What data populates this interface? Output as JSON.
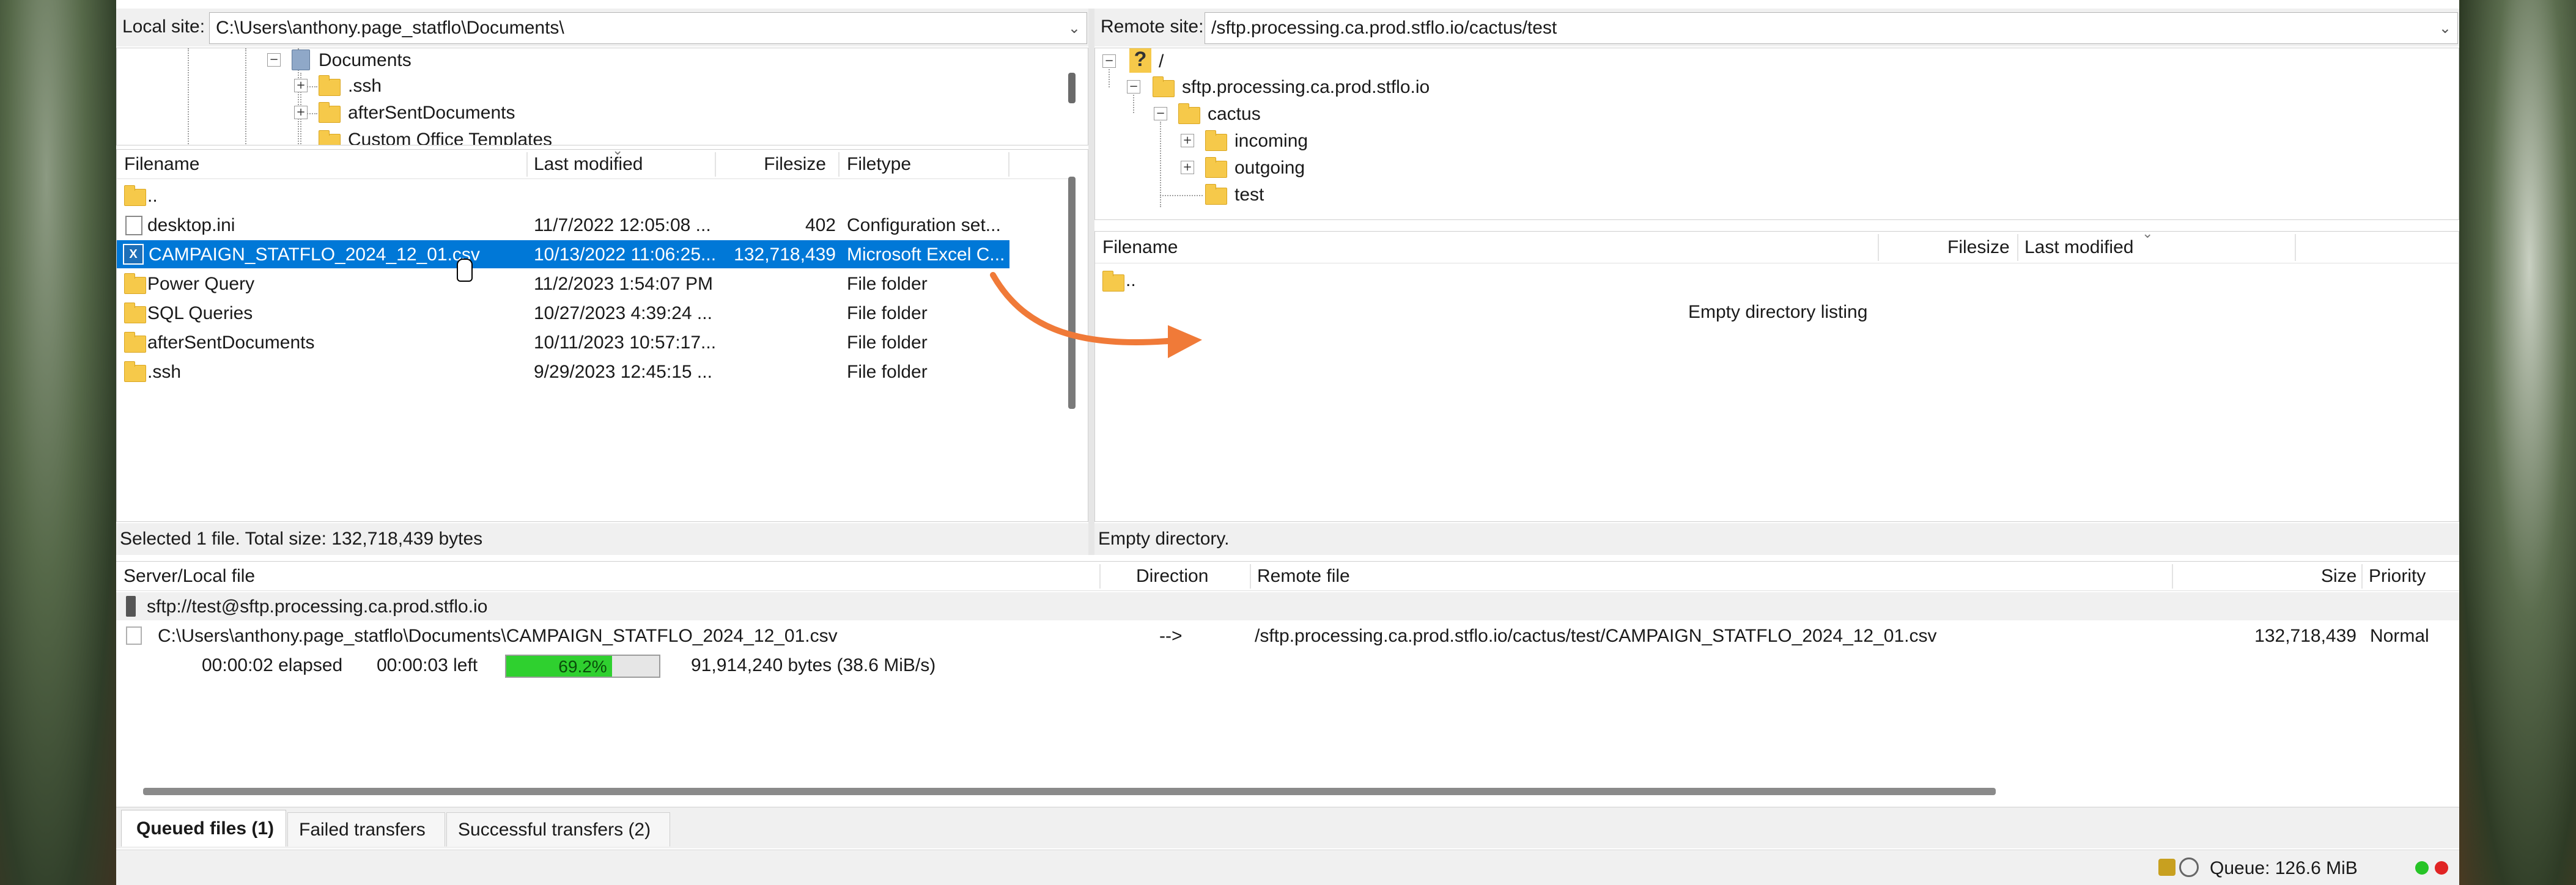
{
  "local": {
    "label": "Local site:",
    "path": "C:\\Users\\anthony.page_statflo\\Documents\\",
    "tree": {
      "documents": "Documents",
      "ssh": ".ssh",
      "after": "afterSentDocuments",
      "custom": "Custom Office Templates"
    },
    "columns": {
      "filename": "Filename",
      "modified": "Last modified",
      "size": "Filesize",
      "type": "Filetype"
    },
    "rows": [
      {
        "name": "..",
        "modified": "",
        "size": "",
        "type": ""
      },
      {
        "name": "desktop.ini",
        "modified": "11/7/2022 12:05:08 ...",
        "size": "402",
        "type": "Configuration set..."
      },
      {
        "name": "CAMPAIGN_STATFLO_2024_12_01.csv",
        "modified": "10/13/2022 11:06:25...",
        "size": "132,718,439",
        "type": "Microsoft Excel C..."
      },
      {
        "name": "Power Query",
        "modified": "11/2/2023 1:54:07 PM",
        "size": "",
        "type": "File folder"
      },
      {
        "name": "SQL Queries",
        "modified": "10/27/2023 4:39:24 ...",
        "size": "",
        "type": "File folder"
      },
      {
        "name": "afterSentDocuments",
        "modified": "10/11/2023 10:57:17...",
        "size": "",
        "type": "File folder"
      },
      {
        "name": ".ssh",
        "modified": "9/29/2023 12:45:15 ...",
        "size": "",
        "type": "File folder"
      }
    ],
    "status": "Selected 1 file. Total size: 132,718,439 bytes"
  },
  "remote": {
    "label": "Remote site:",
    "path": "/sftp.processing.ca.prod.stflo.io/cactus/test",
    "tree": {
      "root": "/",
      "host": "sftp.processing.ca.prod.stflo.io",
      "cactus": "cactus",
      "incoming": "incoming",
      "outgoing": "outgoing",
      "test": "test"
    },
    "columns": {
      "filename": "Filename",
      "size": "Filesize",
      "modified": "Last modified"
    },
    "rows": [
      {
        "name": ".."
      }
    ],
    "empty": "Empty directory listing",
    "status": "Empty directory."
  },
  "queue": {
    "columns": {
      "server": "Server/Local file",
      "direction": "Direction",
      "remote": "Remote file",
      "size": "Size",
      "priority": "Priority"
    },
    "server": "sftp://test@sftp.processing.ca.prod.stflo.io",
    "local_file": "C:\\Users\\anthony.page_statflo\\Documents\\CAMPAIGN_STATFLO_2024_12_01.csv",
    "direction": "-->",
    "remote_file": "/sftp.processing.ca.prod.stflo.io/cactus/test/CAMPAIGN_STATFLO_2024_12_01.csv",
    "size": "132,718,439",
    "priority": "Normal",
    "elapsed": "00:00:02 elapsed",
    "left": "00:00:03 left",
    "progress_label": "69.2%",
    "progress": 0.692,
    "bytes": "91,914,240 bytes (38.6 MiB/s)"
  },
  "tabs": [
    {
      "label": "Queued files (1)"
    },
    {
      "label": "Failed transfers"
    },
    {
      "label": "Successful transfers (2)"
    }
  ],
  "footer": {
    "queue": "Queue: 126.6 MiB"
  },
  "colors": {
    "selection": "#0078d7",
    "arrow": "#f07a38",
    "progress": "#2fd02f",
    "led_green": "#27c427",
    "led_red": "#e02424"
  }
}
